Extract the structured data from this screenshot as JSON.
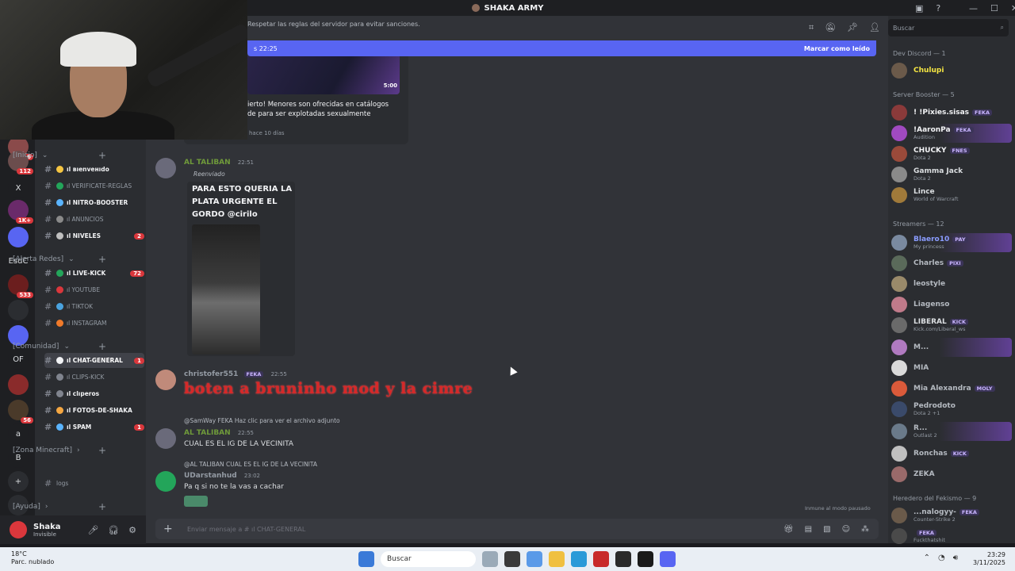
{
  "window": {
    "title": "SHAKA ARMY",
    "controls": [
      "—",
      "☐",
      "✕"
    ]
  },
  "guilds": [
    {
      "label": "",
      "badge": "16",
      "color": "#8a4a4a"
    },
    {
      "label": "",
      "badge": "112",
      "color": "#6b4d4d"
    },
    {
      "label": "X",
      "badge": "",
      "color": "#1e1f22"
    },
    {
      "label": "",
      "badge": "1K+",
      "color": "#6a2a6a"
    },
    {
      "label": "",
      "badge": "",
      "color": "#5865f2"
    },
    {
      "label": "EsdC",
      "badge": "",
      "color": "#1e1f22"
    },
    {
      "label": "",
      "badge": "533",
      "color": "#6b1e1e"
    },
    {
      "label": "",
      "badge": "",
      "color": "#2b2d31"
    },
    {
      "label": "",
      "badge": "",
      "color": "#5865f2"
    },
    {
      "label": "OF",
      "badge": "",
      "color": "#1e1f22"
    },
    {
      "label": "",
      "badge": "",
      "color": "#8a2b2b"
    },
    {
      "label": "",
      "badge": "56",
      "color": "#4a3a2a"
    },
    {
      "label": "a",
      "badge": "",
      "color": "#1e1f22"
    },
    {
      "label": "B",
      "badge": "",
      "color": "#1e1f22"
    },
    {
      "label": "+",
      "badge": "",
      "color": "#2b2d31"
    },
    {
      "label": "",
      "badge": "",
      "color": "#2b2d31"
    }
  ],
  "channels": {
    "categories": [
      {
        "label": "[Inicio]"
      },
      {
        "label": "[Alerta Redes]"
      },
      {
        "label": "[Comunidad]"
      },
      {
        "label": "[Zona Minecraft]"
      },
      {
        "label": "[Ayuda]"
      }
    ],
    "items": [
      {
        "label": "ıl вıenveнıdo",
        "emo": "#f5c542",
        "count": "",
        "style": "bold"
      },
      {
        "label": "ıl VERIFICATE-REGLAS",
        "emo": "#23a55a",
        "count": "",
        "style": ""
      },
      {
        "label": "ıl NITRO-BOOSTER",
        "emo": "#5ab4ff",
        "count": "",
        "style": "bold"
      },
      {
        "label": "ıl ANUNCIOS",
        "emo": "#8a8a8a",
        "count": "",
        "style": ""
      },
      {
        "label": "ıl NIVELES",
        "emo": "#c0c0c0",
        "count": "2",
        "style": "bold"
      },
      {
        "label": "ıl LIVE-KICK",
        "emo": "#23a55a",
        "count": "72",
        "style": "bold"
      },
      {
        "label": "ıl YOUTUBE",
        "emo": "#da373c",
        "count": "",
        "style": ""
      },
      {
        "label": "ıl TIKTOK",
        "emo": "#4aa3df",
        "count": "",
        "style": ""
      },
      {
        "label": "ıl INSTAGRAM",
        "emo": "#f07a2a",
        "count": "",
        "style": ""
      },
      {
        "label": "ıl CHAT-GENERAL",
        "emo": "#f2f3f5",
        "count": "1",
        "style": "sel"
      },
      {
        "label": "ıl CLIPS-KICK",
        "emo": "#80848e",
        "count": "",
        "style": ""
      },
      {
        "label": "ıl clıperos",
        "emo": "#80848e",
        "count": "",
        "style": "bold"
      },
      {
        "label": "ıl FOTOS-DE-SHAKA",
        "emo": "#f5a742",
        "count": "",
        "style": "bold"
      },
      {
        "label": "ıl SPAM",
        "emo": "#5ab4ff",
        "count": "1",
        "style": "bold"
      },
      {
        "label": "logs",
        "emo": "",
        "count": "",
        "style": ""
      }
    ]
  },
  "user": {
    "name": "Shaka",
    "status": "Invisible"
  },
  "header": {
    "topic": "Respetar las reglas del servidor para evitar sanciones.",
    "new_since": "s 22:25",
    "mark_read": "Marcar como leído"
  },
  "embed": {
    "title": "ierto! Menores son ofrecidas en catálogos de para ser explotadas sexualmente",
    "duration": "5:00",
    "age": "hace 10 días"
  },
  "messages": [
    {
      "author": "AL TALIBAN",
      "time": "22:51",
      "color": "#6f9a3a",
      "forwarded": "Reenviado",
      "forward_text": "PARA ESTO QUERIA LA PLATA URGENTE EL GORDO @cirilo"
    },
    {
      "author": "christofer551",
      "time": "22:55",
      "color": "#949ba4",
      "tag": "FEKA",
      "text": "boten a bruninho mod y la cimre"
    },
    {
      "author": "AL TALIBAN",
      "time": "22:55",
      "color": "#6f9a3a",
      "reply": "@SamWay  FEKA  Haz clic para ver el archivo adjunto",
      "text": "CUAL ES EL IG DE LA VECINITA"
    },
    {
      "author": "UDarstanhud",
      "time": "23:02",
      "color": "#949ba4",
      "reply": "@AL TALIBAN  CUAL ES EL IG DE LA VECINITA",
      "text": "Pa q si no te la vas a cachar"
    }
  ],
  "composer": {
    "placeholder": "Enviar mensaje a #  ıl CHAT-GENERAL"
  },
  "slowmode": "Inmune al modo pausado",
  "members": {
    "search_placeholder": "Buscar",
    "sections": [
      {
        "label": "Dev Discord — 1"
      },
      {
        "label": "Server Booster — 5"
      },
      {
        "label": "Streamers — 12"
      },
      {
        "label": "Heredero del Fekismo — 9"
      }
    ],
    "list": [
      {
        "name": "Chulupi",
        "sub": "",
        "color": "#f5e642",
        "tag": "",
        "av": "#6b5a4a",
        "boost": false
      },
      {
        "name": "! !Pixies.sisas",
        "sub": "",
        "color": "#f2f3f5",
        "tag": "FEKA",
        "av": "#8a3a3a",
        "boost": false
      },
      {
        "name": "!AaronPa",
        "sub": "Audition",
        "color": "#f2f3f5",
        "tag": "FEKA",
        "av": "#a04ac0",
        "boost": true
      },
      {
        "name": "CHUCKY",
        "sub": "Dota 2",
        "color": "#f2f3f5",
        "tag": "FNES",
        "av": "#9a4a3a",
        "boost": false
      },
      {
        "name": "Gamma Jack",
        "sub": "Dota 2",
        "color": "#dbdee1",
        "tag": "",
        "av": "#8a8a8a",
        "boost": false
      },
      {
        "name": "Lince",
        "sub": "World of Warcraft",
        "color": "#dbdee1",
        "tag": "",
        "av": "#a07a3a",
        "boost": false
      },
      {
        "name": "Blaero10",
        "sub": "My princess",
        "color": "#8a9cff",
        "tag": "PAY",
        "av": "#7a8aa0",
        "boost": true
      },
      {
        "name": "Charles",
        "sub": "",
        "color": "#b5bac1",
        "tag": "PIXI",
        "av": "#5a6a5a",
        "boost": false
      },
      {
        "name": "leostyle",
        "sub": "",
        "color": "#b5bac1",
        "tag": "",
        "av": "#9a8a6a",
        "boost": false
      },
      {
        "name": "Liagenso",
        "sub": "",
        "color": "#b5bac1",
        "tag": "",
        "av": "#c07a8a",
        "boost": false
      },
      {
        "name": "LIBERAL",
        "sub": "Kick.com/Liberal_ws",
        "color": "#dbdee1",
        "tag": "KICK",
        "av": "#6a6a6a",
        "boost": false
      },
      {
        "name": "M...",
        "sub": "",
        "color": "#b5bac1",
        "tag": "",
        "av": "#b07ac0",
        "boost": true
      },
      {
        "name": "MIA",
        "sub": "",
        "color": "#b5bac1",
        "tag": "",
        "av": "#dadada",
        "boost": false
      },
      {
        "name": "Mia Alexandra",
        "sub": "",
        "color": "#b5bac1",
        "tag": "MOLY",
        "av": "#da5a3a",
        "boost": false
      },
      {
        "name": "Pedrodoto",
        "sub": "Dota 2 +1",
        "color": "#b5bac1",
        "tag": "",
        "av": "#3a4a6a",
        "boost": false
      },
      {
        "name": "R...",
        "sub": "Outlast 2",
        "color": "#b5bac1",
        "tag": "",
        "av": "#6a7a8a",
        "boost": true
      },
      {
        "name": "Ronchas",
        "sub": "",
        "color": "#b5bac1",
        "tag": "KICK",
        "av": "#c0c0c0",
        "boost": false
      },
      {
        "name": "ZEKA",
        "sub": "",
        "color": "#b5bac1",
        "tag": "",
        "av": "#9a6a6a",
        "boost": false
      },
      {
        "name": "...nalogyy-",
        "sub": "Counter-Strike 2",
        "color": "#b5bac1",
        "tag": "FEKA",
        "av": "#6a5a4a",
        "boost": false
      },
      {
        "name": "",
        "sub": "Fuckthatshit",
        "color": "#b5bac1",
        "tag": "FEKA",
        "av": "#4a4a4a",
        "boost": false
      }
    ]
  },
  "taskbar": {
    "weather_temp": "18°C",
    "weather_desc": "Parc. nublado",
    "search": "Buscar",
    "time": "23:29",
    "date": "3/11/2025"
  }
}
